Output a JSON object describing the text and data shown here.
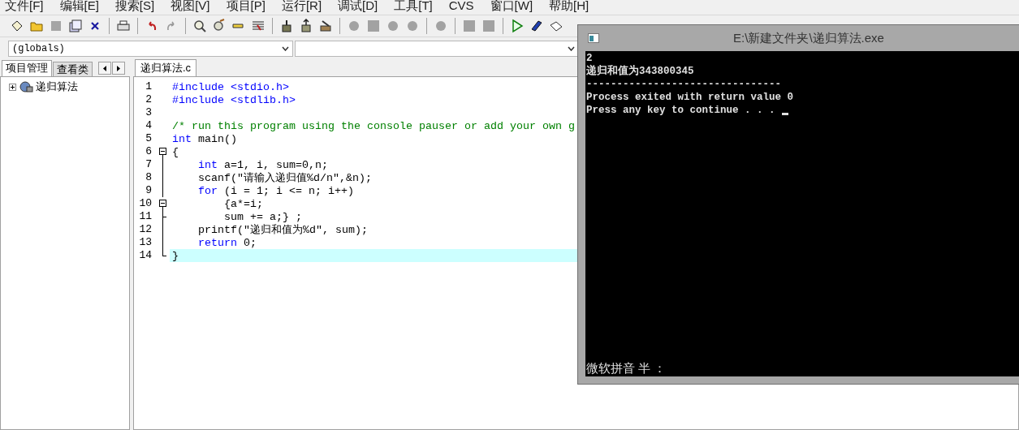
{
  "menu": [
    "文件[F]",
    "编辑[E]",
    "搜索[S]",
    "视图[V]",
    "项目[P]",
    "运行[R]",
    "调试[D]",
    "工具[T]",
    "CVS",
    "窗口[W]",
    "帮助[H]"
  ],
  "toolbar": [
    {
      "kind": "new",
      "disabled": false
    },
    {
      "kind": "open",
      "disabled": false
    },
    {
      "kind": "save",
      "disabled": true
    },
    {
      "kind": "save-all",
      "disabled": false
    },
    {
      "kind": "close",
      "disabled": false
    },
    {
      "kind": "sep"
    },
    {
      "kind": "print",
      "disabled": false
    },
    {
      "kind": "sep"
    },
    {
      "kind": "undo",
      "disabled": false
    },
    {
      "kind": "redo",
      "disabled": true
    },
    {
      "kind": "sep"
    },
    {
      "kind": "find",
      "disabled": false
    },
    {
      "kind": "replace",
      "disabled": false
    },
    {
      "kind": "goto",
      "disabled": false
    },
    {
      "kind": "bookmark",
      "disabled": false
    },
    {
      "kind": "sep"
    },
    {
      "kind": "compile",
      "disabled": false
    },
    {
      "kind": "upload",
      "disabled": false
    },
    {
      "kind": "build",
      "disabled": false
    },
    {
      "kind": "sep"
    },
    {
      "kind": "debug",
      "disabled": true
    },
    {
      "kind": "square",
      "disabled": true
    },
    {
      "kind": "debug",
      "disabled": true
    },
    {
      "kind": "debug",
      "disabled": true
    },
    {
      "kind": "sep"
    },
    {
      "kind": "debug",
      "disabled": true
    },
    {
      "kind": "sep"
    },
    {
      "kind": "square",
      "disabled": true
    },
    {
      "kind": "square",
      "disabled": true
    },
    {
      "kind": "sep"
    },
    {
      "kind": "run",
      "disabled": false
    },
    {
      "kind": "help",
      "disabled": false
    },
    {
      "kind": "about",
      "disabled": false
    }
  ],
  "scope_dropdown": {
    "value": "(globals)"
  },
  "sidebar": {
    "tabs": [
      {
        "label": "项目管理",
        "selected": true
      },
      {
        "label": "查看类",
        "selected": false
      }
    ],
    "tree": [
      {
        "label": "递归算法",
        "expanded": false
      }
    ]
  },
  "editor": {
    "tabs": [
      {
        "label": "递归算法.c",
        "selected": true
      }
    ],
    "lines": [
      {
        "number": "1",
        "kind": "plain",
        "current": false,
        "tokens": [
          {
            "kind": "preproc",
            "text": "#include <stdio.h>"
          }
        ]
      },
      {
        "number": "2",
        "kind": "plain",
        "current": false,
        "tokens": [
          {
            "kind": "preproc",
            "text": "#include <stdlib.h>"
          }
        ]
      },
      {
        "number": "3",
        "kind": "plain",
        "current": false
      },
      {
        "number": "4",
        "kind": "plain",
        "current": false,
        "tokens": [
          {
            "kind": "comment",
            "text": "/* run this program using the console pauser or add your own g"
          }
        ]
      },
      {
        "number": "5",
        "kind": "plain",
        "current": false,
        "tokens": [
          {
            "kind": "keyword",
            "text": "int"
          },
          {
            "kind": "plain",
            "text": " main()"
          }
        ]
      },
      {
        "number": "6",
        "kind": "fold-start",
        "current": false,
        "tokens": [
          {
            "kind": "plain",
            "text": "{"
          }
        ]
      },
      {
        "number": "7",
        "kind": "fold-body",
        "current": false,
        "tokens": [
          {
            "kind": "keyword",
            "text": "    int"
          },
          {
            "kind": "plain",
            "text": " a=1, i, sum=0,n;"
          }
        ]
      },
      {
        "number": "8",
        "kind": "fold-body",
        "current": false,
        "tokens": [
          {
            "kind": "plain",
            "text": "    scanf(\"请输入递归值%d/n\",&n);"
          }
        ]
      },
      {
        "number": "9",
        "kind": "fold-body",
        "current": false,
        "tokens": [
          {
            "kind": "keyword",
            "text": "    for"
          },
          {
            "kind": "plain",
            "text": " (i = 1; i <= n; i++)"
          }
        ]
      },
      {
        "number": "10",
        "kind": "fold-start",
        "current": false,
        "tokens": [
          {
            "kind": "plain",
            "text": "        {a*=i;"
          }
        ]
      },
      {
        "number": "11",
        "kind": "fold-inner-end",
        "current": false,
        "tokens": [
          {
            "kind": "plain",
            "text": "        sum += a;} ;"
          }
        ]
      },
      {
        "number": "12",
        "kind": "fold-body",
        "current": false,
        "tokens": [
          {
            "kind": "plain",
            "text": "    printf(\"递归和值为%d\", sum);"
          }
        ]
      },
      {
        "number": "13",
        "kind": "fold-body",
        "current": false,
        "tokens": [
          {
            "kind": "keyword",
            "text": "    return"
          },
          {
            "kind": "plain",
            "text": " 0;"
          }
        ]
      },
      {
        "number": "14",
        "kind": "fold-end",
        "current": true,
        "tokens": [
          {
            "kind": "plain",
            "text": "}"
          }
        ]
      }
    ]
  },
  "console": {
    "title": "E:\\新建文件夹\\递归算法.exe",
    "lines": [
      "2",
      "递归和值为343800345",
      "--------------------------------",
      "Process exited with return value 0",
      "Press any key to continue . . ."
    ],
    "ime_status": "微软拼音 半 ："
  }
}
